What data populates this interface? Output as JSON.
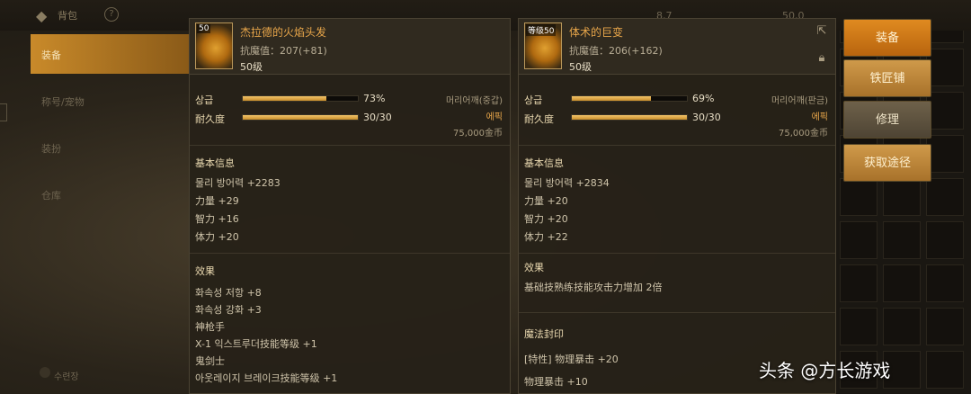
{
  "topbar": {
    "back_icon": "back-arrow-icon",
    "title": "背包",
    "help_icon": "question-icon",
    "currency_a": "8,7",
    "currency_b": "50,0"
  },
  "sidebar": {
    "items": [
      {
        "label": "装备",
        "active": true
      },
      {
        "label": "称号/宠物",
        "active": false
      },
      {
        "label": "装扮",
        "active": false
      },
      {
        "label": "仓库",
        "active": false
      }
    ],
    "bottom_label": "수련장"
  },
  "panel_left": {
    "icon_label": "50",
    "name": "杰拉德的火焰头发",
    "resist": "抗魔值：207(+81)",
    "level": "50级",
    "grade_label": "상급",
    "grade_percent": 73,
    "grade_text": "73%",
    "durability_label": "耐久度",
    "durability_percent": 100,
    "durability_text": "30/30",
    "slot_type": "머리어깨(중갑)",
    "rarity": "에픽",
    "price": "75,000金币",
    "basic_title": "基本信息",
    "basic_stats": [
      "물리 방어력 +2283",
      "力量 +29",
      "智力 +16",
      "体力 +20"
    ],
    "effect_title": "效果",
    "effects": [
      "화속성 저항 +8",
      "화속성 강화 +3",
      "神枪手",
      "X-1 익스트루더技能等级 +1",
      "鬼剑士",
      "아웃레이지 브레이크技能等级 +1"
    ]
  },
  "panel_right": {
    "icon_label": "等级50",
    "name": "体术的巨变",
    "resist": "抗魔值：206(+162)",
    "level": "50级",
    "grade_label": "상급",
    "grade_percent": 69,
    "grade_text": "69%",
    "durability_label": "耐久度",
    "durability_percent": 100,
    "durability_text": "30/30",
    "slot_type": "머리어깨(판금)",
    "rarity": "에픽",
    "price": "75,000金币",
    "basic_title": "基本信息",
    "basic_stats": [
      "물리 방어력 +2834",
      "力量 +20",
      "智力 +20",
      "体力 +22"
    ],
    "effect_title": "效果",
    "effects": [
      "基础技熟练技能攻击力增加 2倍"
    ],
    "seal_title": "魔法封印",
    "seal_stats": [
      "[特性] 物理暴击 +20",
      "物理暴击 +10"
    ],
    "compare_icon": "external-compare-icon",
    "lock_icon": "lock-icon"
  },
  "buttons": {
    "equip": "装备",
    "blacksmith": "铁匠铺",
    "repair": "修理",
    "obtain": "获取途径"
  },
  "watermark": "头条 @方长游戏",
  "colors": {
    "accent_orange": "#e08a20",
    "rarity_epic": "#e8a64a",
    "bar_fill": "#f2c46a"
  }
}
